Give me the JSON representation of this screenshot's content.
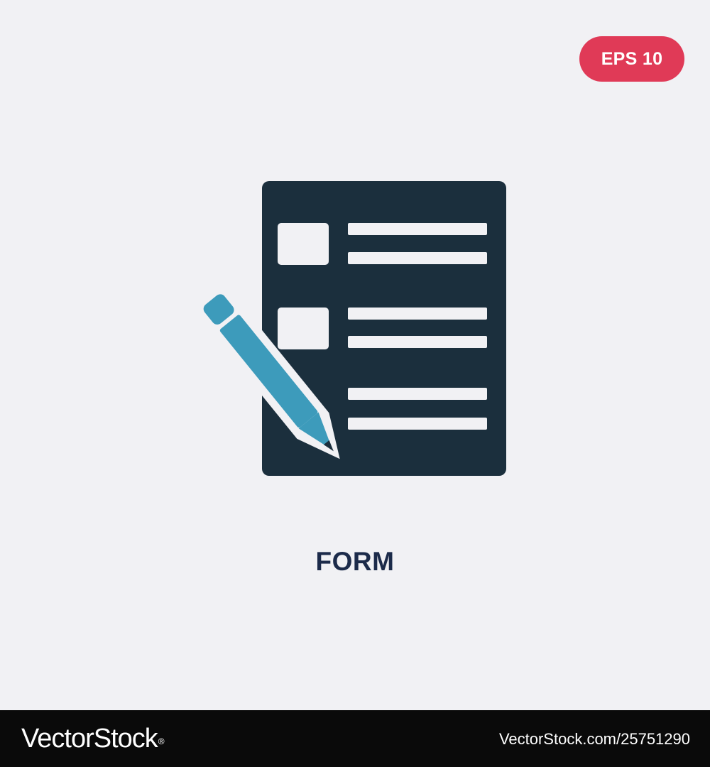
{
  "badge": {
    "label": "EPS 10",
    "color": "#e03a57"
  },
  "icon": {
    "name": "form-icon",
    "primary_color": "#1b2f3d",
    "accent_color": "#3d9bbb"
  },
  "title": "FORM",
  "footer": {
    "logo_text": "VectorStock",
    "logo_mark": "®",
    "image_url": "VectorStock.com/25751290"
  },
  "colors": {
    "background": "#f1f1f4",
    "title": "#1c2b4a",
    "footer_background": "#0a0a0a"
  }
}
